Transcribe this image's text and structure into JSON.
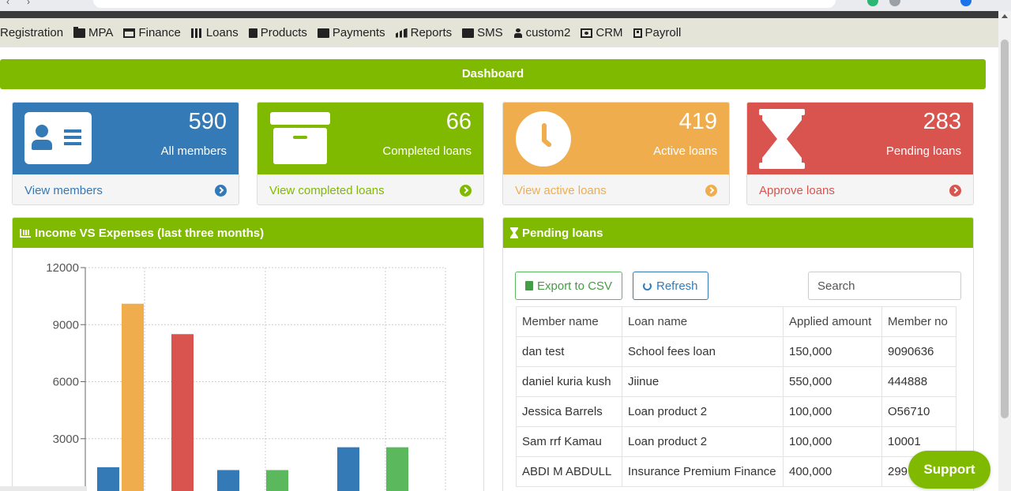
{
  "menu": {
    "items": [
      {
        "label": "Registration",
        "icon": "list-icon"
      },
      {
        "label": "MPA",
        "icon": "folder-icon"
      },
      {
        "label": "Finance",
        "icon": "inbox-icon"
      },
      {
        "label": "Loans",
        "icon": "table-icon"
      },
      {
        "label": "Products",
        "icon": "document-icon"
      },
      {
        "label": "Payments",
        "icon": "envelope-icon"
      },
      {
        "label": "Reports",
        "icon": "bar-chart-icon"
      },
      {
        "label": "SMS",
        "icon": "mail-icon"
      },
      {
        "label": "custom2",
        "icon": "person-icon"
      },
      {
        "label": "CRM",
        "icon": "portrait-icon"
      },
      {
        "label": "Payroll",
        "icon": "id-badge-icon"
      }
    ]
  },
  "dashboard": {
    "title": "Dashboard"
  },
  "cards": [
    {
      "value": "590",
      "label": "All members",
      "link": "View members",
      "color": "#337ab7"
    },
    {
      "value": "66",
      "label": "Completed loans",
      "link": "View completed loans",
      "color": "#7fba00"
    },
    {
      "value": "419",
      "label": "Active loans",
      "link": "View active loans",
      "color": "#f0ad4e"
    },
    {
      "value": "283",
      "label": "Pending loans",
      "link": "Approve loans",
      "color": "#d9534f"
    }
  ],
  "income_panel": {
    "title": "Income VS Expenses (last three months)"
  },
  "chart_data": {
    "type": "bar",
    "title": "Income VS Expenses (last three months)",
    "ylim": [
      0,
      12000
    ],
    "yticks": [
      3000,
      6000,
      9000,
      12000
    ],
    "grid": true,
    "bars": [
      {
        "group": 0,
        "value": 1500,
        "color": "#337ab7"
      },
      {
        "group": 0,
        "value": 10100,
        "color": "#f0ad4e"
      },
      {
        "group": 1,
        "value": 8500,
        "color": "#d9534f"
      },
      {
        "group": 1,
        "value": 1350,
        "color": "#337ab7"
      },
      {
        "group": 1,
        "value": 1350,
        "color": "#5cb85c"
      },
      {
        "group": 2,
        "value": 2550,
        "color": "#337ab7"
      },
      {
        "group": 2,
        "value": 2550,
        "color": "#5cb85c"
      }
    ]
  },
  "loans_panel": {
    "title": "Pending loans",
    "export_label": "Export to CSV",
    "refresh_label": "Refresh",
    "search_placeholder": "Search",
    "columns": [
      "Member name",
      "Loan name",
      "Applied amount",
      "Member no"
    ],
    "rows": [
      [
        "dan test",
        "School fees loan",
        "150,000",
        "9090636"
      ],
      [
        "daniel kuria kush",
        "Jiinue",
        "550,000",
        "444888"
      ],
      [
        "Jessica Barrels",
        "Loan product 2",
        "100,000",
        "O56710"
      ],
      [
        "Sam rrf Kamau",
        "Loan product 2",
        "100,000",
        "10001"
      ],
      [
        "ABDI M ABDULL",
        "Insurance Premium Finance",
        "400,000",
        "299"
      ]
    ]
  },
  "support": {
    "label": "Support"
  }
}
